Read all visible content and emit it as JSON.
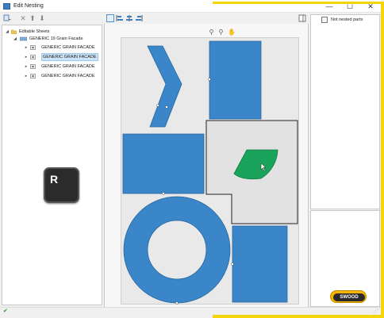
{
  "window": {
    "title": "Edit Nesting",
    "minimize_glyph": "—",
    "maximize_glyph": "☐",
    "close_glyph": "✕"
  },
  "left_toolbar": {
    "icons": [
      "sheets-menu-icon",
      "delete-icon",
      "move-up-icon",
      "move-down-icon"
    ]
  },
  "tree": {
    "root": {
      "label": "Editable Sheets",
      "expanded": true
    },
    "group": {
      "label": "GENERIC 19 Grain Facade",
      "expanded": true
    },
    "sheets": [
      {
        "label": "GENERIC GRAIN FACADE",
        "selected": false
      },
      {
        "label": "GENERIC GRAIN FACADE",
        "selected": true
      },
      {
        "label": "GENERIC GRAIN FACADE",
        "selected": false
      },
      {
        "label": "GENERIC GRAIN FACADE",
        "selected": false
      }
    ]
  },
  "key_overlay": {
    "key": "R"
  },
  "center_toolbar": {
    "icons": [
      "nest-view-icon",
      "align-left-icon",
      "align-center-icon",
      "align-right-icon"
    ],
    "zoom_icons": [
      "zoom-in-icon",
      "zoom-fit-icon",
      "pan-icon"
    ]
  },
  "right_pane": {
    "not_nested_label": "Not nested parts"
  },
  "logo": {
    "text": "SWOOD"
  },
  "colors": {
    "part_fill": "#3a86c9",
    "part_stroke": "#27669f",
    "selected_part_fill": "#1aa35a",
    "highlight_yellow": "#f5d50a"
  }
}
